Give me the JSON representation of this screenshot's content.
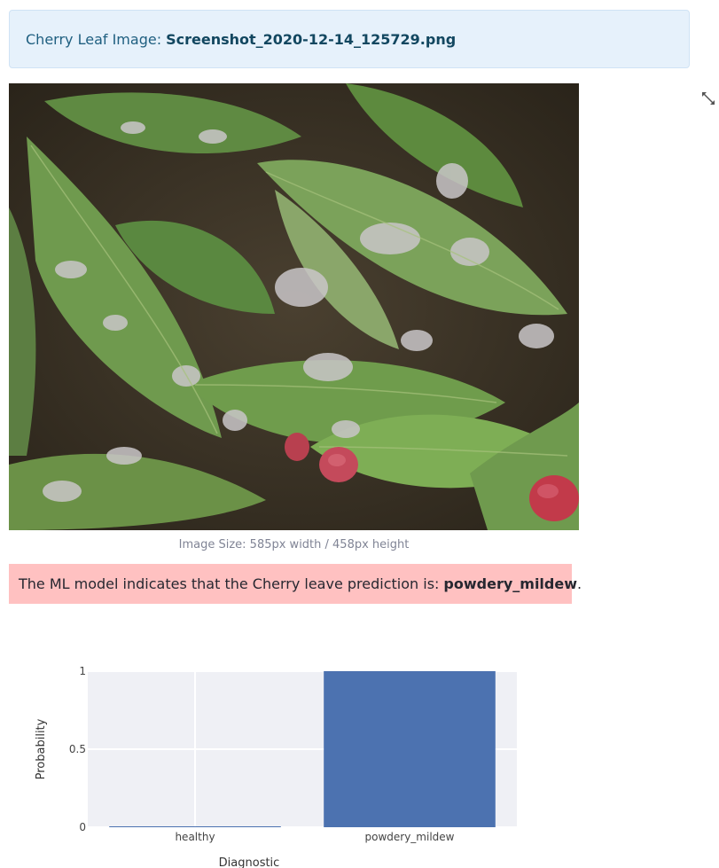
{
  "header": {
    "label": "Cherry Leaf Image:",
    "filename": "Screenshot_2020-12-14_125729.png"
  },
  "image": {
    "caption": "Image Size: 585px width / 458px height"
  },
  "prediction": {
    "text": "The ML model indicates that the Cherry leave prediction is:",
    "value": "powdery_mildew",
    "suffix": "."
  },
  "icons": {
    "expand": "fullscreen-expand-icon"
  },
  "colors": {
    "info_bg": "#e6f1fb",
    "prediction_bg": "#ffc1c1",
    "bar": "#4c72b0",
    "plot_bg": "#eff0f5"
  },
  "chart_data": {
    "type": "bar",
    "categories": [
      "healthy",
      "powdery_mildew"
    ],
    "values": [
      0,
      1
    ],
    "xlabel": "Diagnostic",
    "ylabel": "Probability",
    "ylim": [
      0,
      1
    ],
    "yticks": [
      0,
      0.5,
      1
    ],
    "grid": true
  }
}
